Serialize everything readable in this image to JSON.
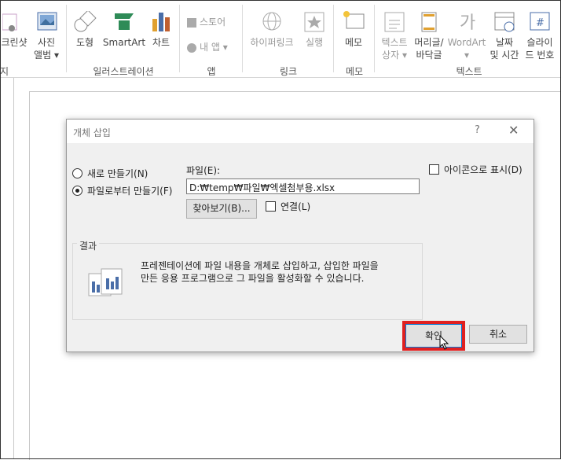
{
  "ribbon": {
    "screenshot_partial": "크린샷",
    "photo_album": [
      "사진",
      "앨범"
    ],
    "shapes": "도형",
    "smartart": "SmartArt",
    "chart": "차트",
    "store": "스토어",
    "my_apps": "내 앱",
    "hyperlink": "하이퍼링크",
    "action": "실행",
    "memo": "메모",
    "textbox": [
      "텍스트",
      "상자"
    ],
    "header_footer": [
      "머리글/",
      "바닥글"
    ],
    "wordart": "WordArt",
    "date_time": [
      "날짜",
      "및 시간"
    ],
    "slide_number": [
      "슬라이",
      "드 번호"
    ],
    "groups": {
      "partial": "지",
      "illustrations": "일러스트레이션",
      "apps": "앱",
      "links": "링크",
      "comments": "메모",
      "text": "텍스트"
    }
  },
  "dialog": {
    "title": "개체 삽입",
    "help": "?",
    "close": "✕",
    "radio_new": "새로 만들기(N)",
    "radio_from_file": "파일로부터 만들기(F)",
    "file_label": "파일(E):",
    "file_path": "D:₩temp₩파일₩엑셀첨부용.xlsx",
    "browse": "찾아보기(B)...",
    "link": "연결(L)",
    "display_as_icon": "아이콘으로 표시(D)",
    "result_title": "결과",
    "result_text_1": "프레젠테이션에 파일 내용을 개체로 삽입하고, 삽입한 파일을",
    "result_text_2": "만든 응용 프로그램으로 그 파일을 활성화할 수 있습니다.",
    "ok": "확인",
    "cancel": "취소"
  },
  "colors": {
    "highlight": "#e02020"
  }
}
